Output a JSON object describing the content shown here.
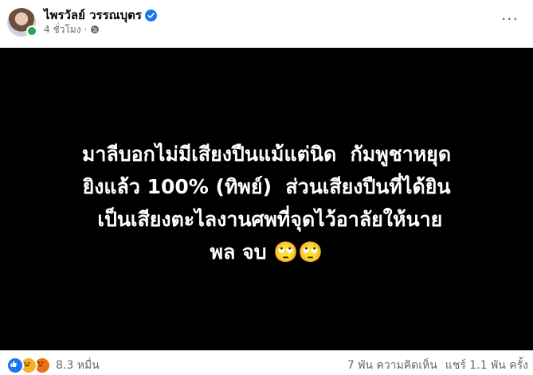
{
  "post": {
    "author": "ไพรวัลย์ วรรณบุตร",
    "timestamp": "4 ชั่วโมง",
    "separator": "·",
    "more_label": "···",
    "body_lines": [
      "มาลีบอกไม่มีเสียงปืนแม้แต่นิด ￼ กัมพูชาหยุด",
      "ยิงแล้ว 100% (ทิพย์) ￼ ส่วนเสียงปืนที่ได้ยิน",
      "￼ เป็นเสียงตะไลงานศพที่จุดไว้อาลัยให้นาย",
      "พล จบ 🙄🙄"
    ],
    "background_color": "#000000",
    "text_color": "#ffffff"
  },
  "footer": {
    "reaction_icons": [
      "like-icon",
      "haha-icon",
      "angry-icon"
    ],
    "reaction_count": "8.3 หมื่น",
    "comments": "7 พัน ความคิดเห็น",
    "shares": "แชร์ 1.1 พัน ครั้ง"
  },
  "colors": {
    "verified": "#1877f2",
    "online": "#31a24c",
    "meta_text": "#65676b"
  }
}
